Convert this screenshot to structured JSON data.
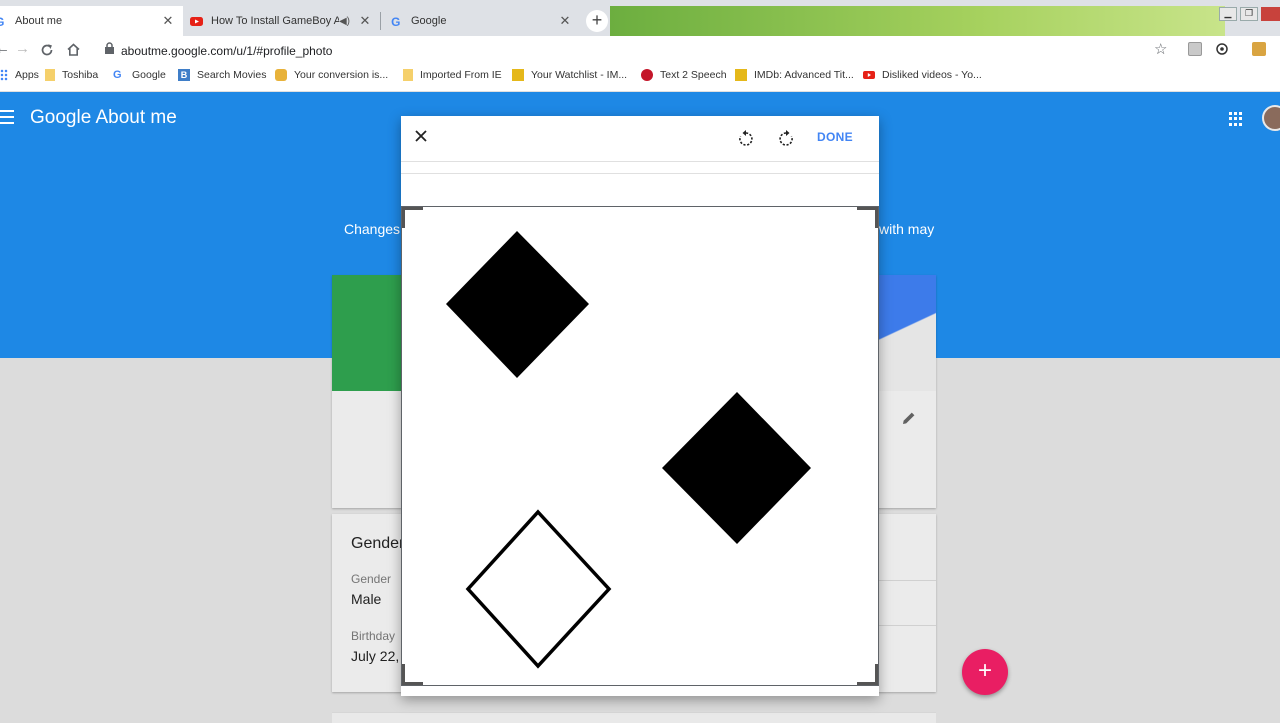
{
  "browser": {
    "tabs": [
      {
        "title": "About me",
        "active": true,
        "favicon": "google-g-icon"
      },
      {
        "title": "How To Install GameBoy Adv",
        "active": false,
        "favicon": "youtube-icon",
        "audio": true
      },
      {
        "title": "Google",
        "active": false,
        "favicon": "google-g-icon"
      }
    ],
    "new_tab_symbol": "+",
    "url": "aboutme.google.com/u/1/#profile_photo",
    "bookmarks": [
      {
        "label": "Apps",
        "icon": "apps-grid-icon"
      },
      {
        "label": "Toshiba",
        "icon": "folder-icon"
      },
      {
        "label": "Google",
        "icon": "google-g-icon"
      },
      {
        "label": "Search Movies",
        "icon": "b-icon"
      },
      {
        "label": "Your conversion is...",
        "icon": "conversion-icon"
      },
      {
        "label": "Imported From IE",
        "icon": "folder-icon"
      },
      {
        "label": "Your Watchlist - IM...",
        "icon": "imdb-icon"
      },
      {
        "label": "Text 2 Speech",
        "icon": "speech-bubble-icon"
      },
      {
        "label": "IMDb: Advanced Tit...",
        "icon": "imdb-icon"
      },
      {
        "label": "Disliked videos - Yo...",
        "icon": "youtube-icon"
      }
    ]
  },
  "page": {
    "brand": "Google About me",
    "notice_left": "Changes y",
    "notice_right": "with may",
    "gender_section": {
      "title": "Gender",
      "gender_label": "Gender",
      "gender_value": "Male",
      "birthday_label": "Birthday",
      "birthday_value": "July 22,"
    },
    "fab_symbol": "+"
  },
  "dialog": {
    "done_label": "DONE",
    "close_symbol": "×"
  },
  "colors": {
    "header_blue": "#1e88e5",
    "card_green": "#2e9e4d",
    "fab_pink": "#e91e63",
    "done_blue": "#4285f4"
  }
}
